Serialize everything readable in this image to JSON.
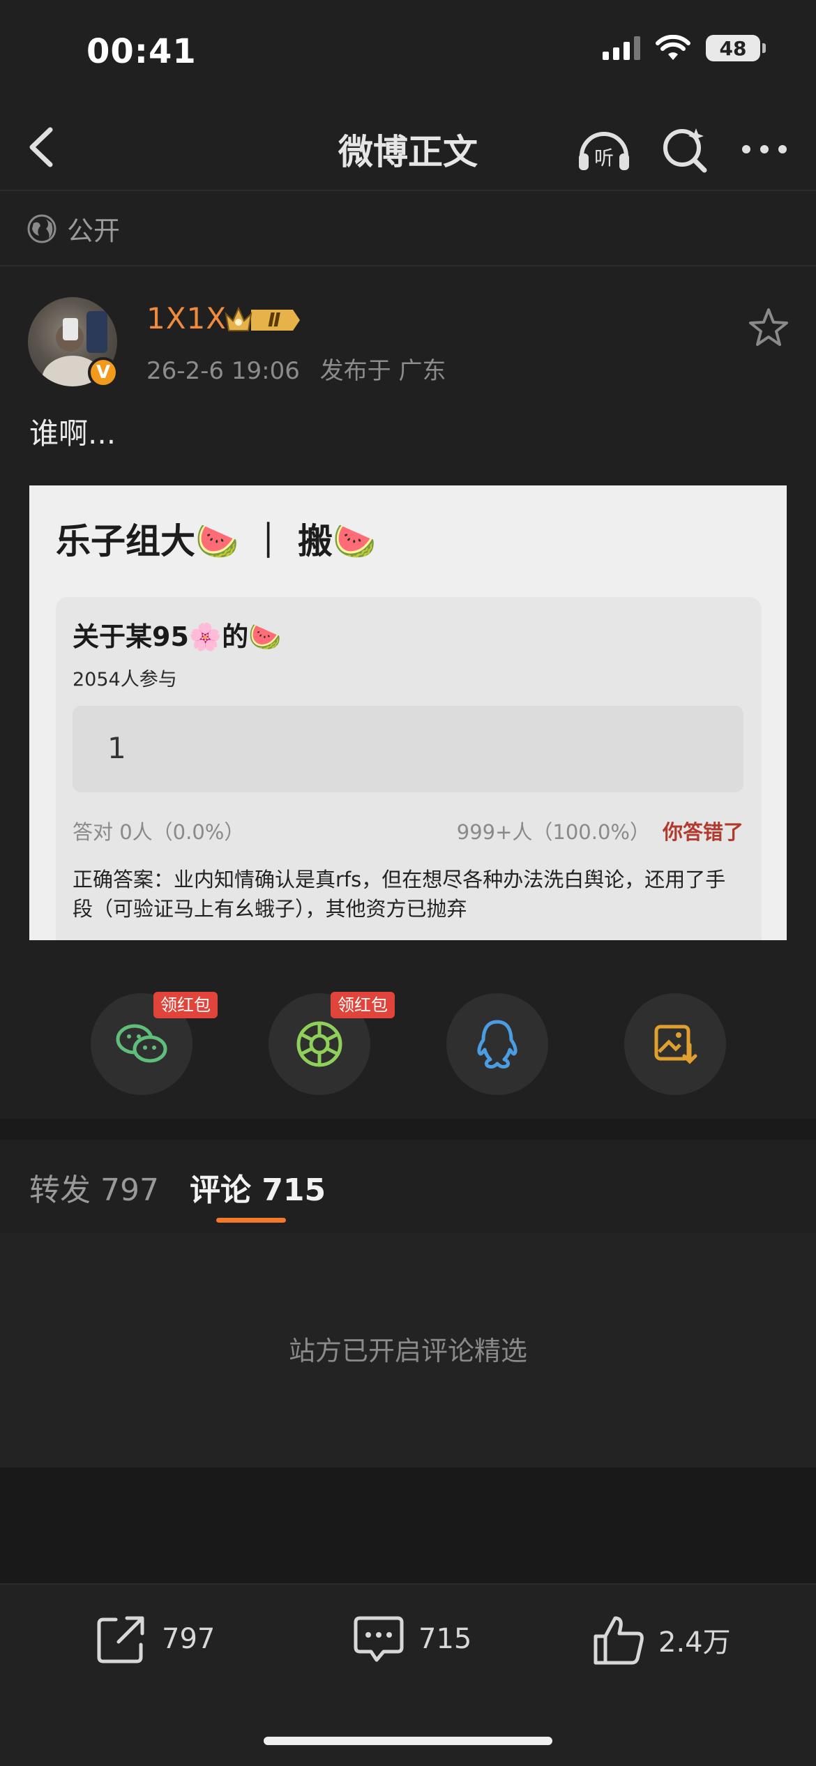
{
  "status_bar": {
    "time": "00:41",
    "battery": "48"
  },
  "nav": {
    "title": "微博正文"
  },
  "visibility": {
    "label": "公开"
  },
  "post": {
    "username": "1X1X",
    "rank_badge": "Ⅱ",
    "verified_mark": "V",
    "timestamp": "26-2-6 19:06",
    "location": "发布于 广东",
    "text": "谁啊..."
  },
  "embedded_image": {
    "title": "乐子组大🍉 ｜ 搬🍉",
    "question_title": "关于某95🌸的🍉",
    "participants": "2054人参与",
    "answer_value": "1",
    "stats_left": "答对  0人（0.0%）",
    "stats_right": "999+人（100.0%）",
    "wrong_label": "你答错了",
    "correct_answer": "正确答案：业内知情确认是真rfs，但在想尽各种办法洗白舆论，还用了手段（可验证马上有幺蛾子），其他资方已抛弃"
  },
  "share": {
    "redpacket_label": "领红包",
    "items": [
      "wechat-icon",
      "moments-icon",
      "qq-icon",
      "save-image-icon"
    ]
  },
  "tabs": {
    "repost": "转发 797",
    "comment": "评论 715"
  },
  "comments": {
    "note": "站方已开启评论精选"
  },
  "bottom_bar": {
    "repost_count": "797",
    "comment_count": "715",
    "like_count": "2.4万"
  },
  "colors": {
    "accent": "#f07a2a",
    "username": "#f08a3c",
    "red_packet": "#e0443a",
    "wrong": "#b03a2e"
  }
}
